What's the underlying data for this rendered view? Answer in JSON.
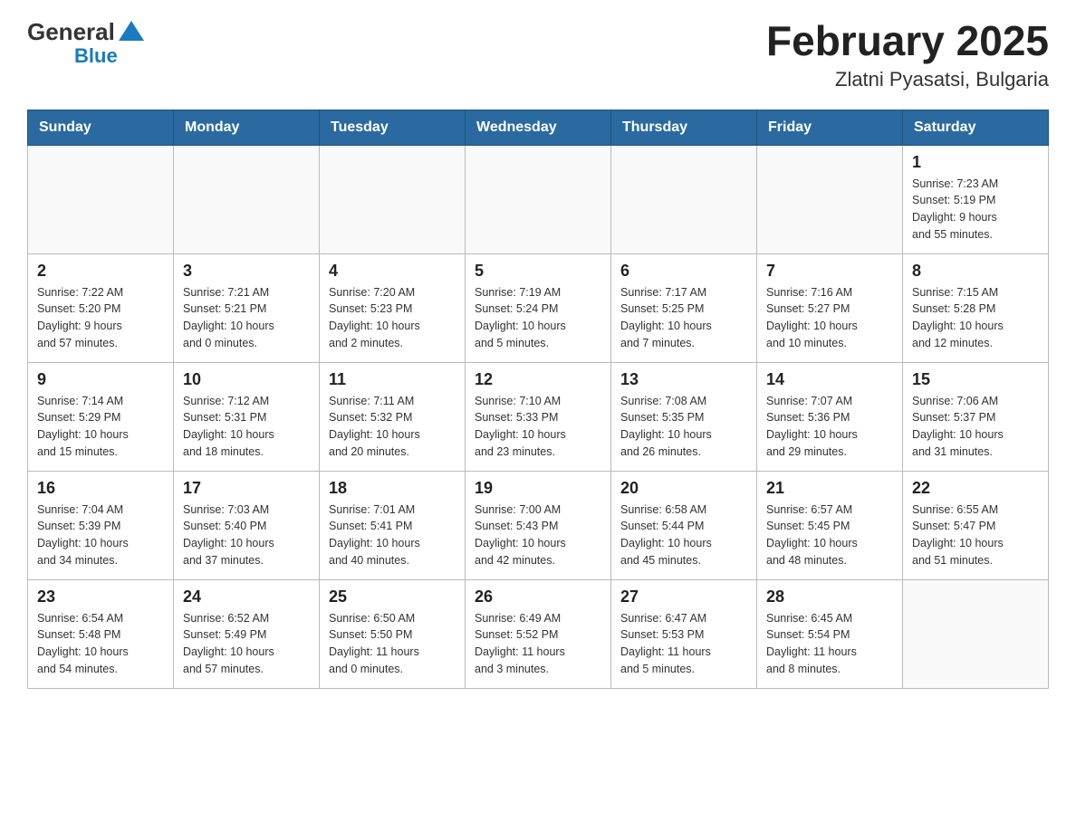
{
  "header": {
    "title": "February 2025",
    "subtitle": "Zlatni Pyasatsi, Bulgaria",
    "logo": {
      "general": "General",
      "blue": "Blue"
    }
  },
  "weekdays": [
    "Sunday",
    "Monday",
    "Tuesday",
    "Wednesday",
    "Thursday",
    "Friday",
    "Saturday"
  ],
  "weeks": [
    [
      {
        "day": "",
        "info": ""
      },
      {
        "day": "",
        "info": ""
      },
      {
        "day": "",
        "info": ""
      },
      {
        "day": "",
        "info": ""
      },
      {
        "day": "",
        "info": ""
      },
      {
        "day": "",
        "info": ""
      },
      {
        "day": "1",
        "info": "Sunrise: 7:23 AM\nSunset: 5:19 PM\nDaylight: 9 hours\nand 55 minutes."
      }
    ],
    [
      {
        "day": "2",
        "info": "Sunrise: 7:22 AM\nSunset: 5:20 PM\nDaylight: 9 hours\nand 57 minutes."
      },
      {
        "day": "3",
        "info": "Sunrise: 7:21 AM\nSunset: 5:21 PM\nDaylight: 10 hours\nand 0 minutes."
      },
      {
        "day": "4",
        "info": "Sunrise: 7:20 AM\nSunset: 5:23 PM\nDaylight: 10 hours\nand 2 minutes."
      },
      {
        "day": "5",
        "info": "Sunrise: 7:19 AM\nSunset: 5:24 PM\nDaylight: 10 hours\nand 5 minutes."
      },
      {
        "day": "6",
        "info": "Sunrise: 7:17 AM\nSunset: 5:25 PM\nDaylight: 10 hours\nand 7 minutes."
      },
      {
        "day": "7",
        "info": "Sunrise: 7:16 AM\nSunset: 5:27 PM\nDaylight: 10 hours\nand 10 minutes."
      },
      {
        "day": "8",
        "info": "Sunrise: 7:15 AM\nSunset: 5:28 PM\nDaylight: 10 hours\nand 12 minutes."
      }
    ],
    [
      {
        "day": "9",
        "info": "Sunrise: 7:14 AM\nSunset: 5:29 PM\nDaylight: 10 hours\nand 15 minutes."
      },
      {
        "day": "10",
        "info": "Sunrise: 7:12 AM\nSunset: 5:31 PM\nDaylight: 10 hours\nand 18 minutes."
      },
      {
        "day": "11",
        "info": "Sunrise: 7:11 AM\nSunset: 5:32 PM\nDaylight: 10 hours\nand 20 minutes."
      },
      {
        "day": "12",
        "info": "Sunrise: 7:10 AM\nSunset: 5:33 PM\nDaylight: 10 hours\nand 23 minutes."
      },
      {
        "day": "13",
        "info": "Sunrise: 7:08 AM\nSunset: 5:35 PM\nDaylight: 10 hours\nand 26 minutes."
      },
      {
        "day": "14",
        "info": "Sunrise: 7:07 AM\nSunset: 5:36 PM\nDaylight: 10 hours\nand 29 minutes."
      },
      {
        "day": "15",
        "info": "Sunrise: 7:06 AM\nSunset: 5:37 PM\nDaylight: 10 hours\nand 31 minutes."
      }
    ],
    [
      {
        "day": "16",
        "info": "Sunrise: 7:04 AM\nSunset: 5:39 PM\nDaylight: 10 hours\nand 34 minutes."
      },
      {
        "day": "17",
        "info": "Sunrise: 7:03 AM\nSunset: 5:40 PM\nDaylight: 10 hours\nand 37 minutes."
      },
      {
        "day": "18",
        "info": "Sunrise: 7:01 AM\nSunset: 5:41 PM\nDaylight: 10 hours\nand 40 minutes."
      },
      {
        "day": "19",
        "info": "Sunrise: 7:00 AM\nSunset: 5:43 PM\nDaylight: 10 hours\nand 42 minutes."
      },
      {
        "day": "20",
        "info": "Sunrise: 6:58 AM\nSunset: 5:44 PM\nDaylight: 10 hours\nand 45 minutes."
      },
      {
        "day": "21",
        "info": "Sunrise: 6:57 AM\nSunset: 5:45 PM\nDaylight: 10 hours\nand 48 minutes."
      },
      {
        "day": "22",
        "info": "Sunrise: 6:55 AM\nSunset: 5:47 PM\nDaylight: 10 hours\nand 51 minutes."
      }
    ],
    [
      {
        "day": "23",
        "info": "Sunrise: 6:54 AM\nSunset: 5:48 PM\nDaylight: 10 hours\nand 54 minutes."
      },
      {
        "day": "24",
        "info": "Sunrise: 6:52 AM\nSunset: 5:49 PM\nDaylight: 10 hours\nand 57 minutes."
      },
      {
        "day": "25",
        "info": "Sunrise: 6:50 AM\nSunset: 5:50 PM\nDaylight: 11 hours\nand 0 minutes."
      },
      {
        "day": "26",
        "info": "Sunrise: 6:49 AM\nSunset: 5:52 PM\nDaylight: 11 hours\nand 3 minutes."
      },
      {
        "day": "27",
        "info": "Sunrise: 6:47 AM\nSunset: 5:53 PM\nDaylight: 11 hours\nand 5 minutes."
      },
      {
        "day": "28",
        "info": "Sunrise: 6:45 AM\nSunset: 5:54 PM\nDaylight: 11 hours\nand 8 minutes."
      },
      {
        "day": "",
        "info": ""
      }
    ]
  ],
  "colors": {
    "header_bg": "#2b6aa0",
    "header_text": "#ffffff",
    "border": "#bbbbbb",
    "accent": "#1a7abf"
  }
}
